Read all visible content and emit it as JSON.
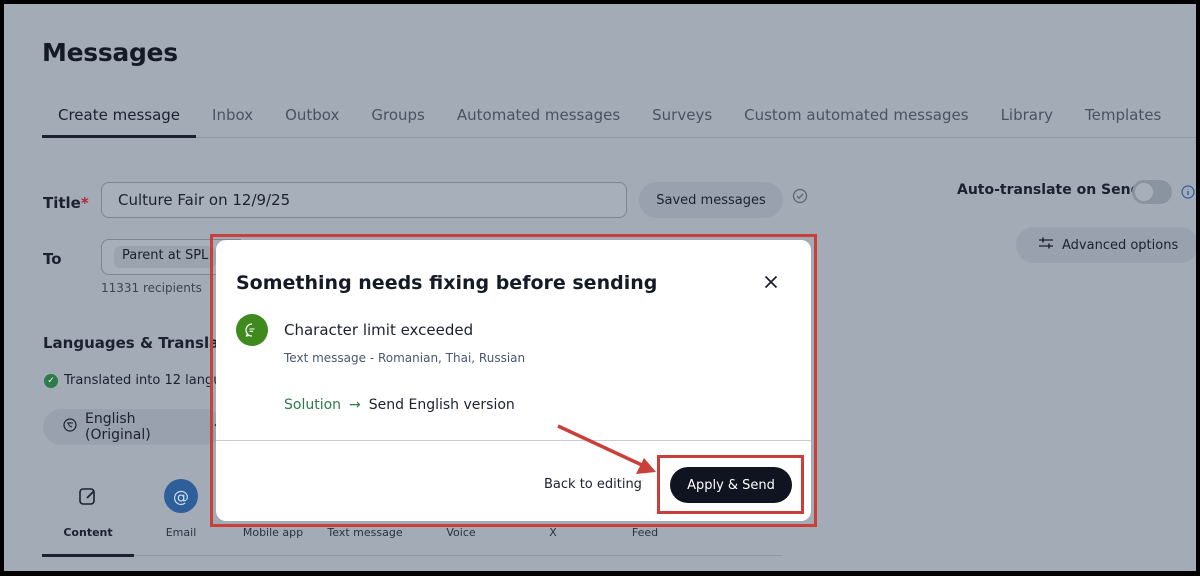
{
  "page": {
    "title": "Messages"
  },
  "tabs": [
    {
      "label": "Create message",
      "active": true
    },
    {
      "label": "Inbox"
    },
    {
      "label": "Outbox"
    },
    {
      "label": "Groups"
    },
    {
      "label": "Automated messages"
    },
    {
      "label": "Surveys"
    },
    {
      "label": "Custom automated messages"
    },
    {
      "label": "Library"
    },
    {
      "label": "Templates"
    }
  ],
  "form": {
    "title_label": "Title",
    "required_mark": "*",
    "title_value": "Culture Fair on 12/9/25",
    "saved_messages_label": "Saved messages",
    "to_label": "To",
    "to_chip": "Parent at SPL",
    "recipients": "11331 recipients",
    "languages_label": "Languages & Translation",
    "translated_note": "Translated into 12 langu",
    "language_pill": "English (Original)",
    "auto_translate_label": "Auto-translate on Send",
    "advanced_options_label": "Advanced options"
  },
  "channels": [
    {
      "label": "Content",
      "icon": "edit-icon",
      "active": true
    },
    {
      "label": "Email",
      "icon": "at-icon"
    },
    {
      "label": "Mobile app",
      "icon": ""
    },
    {
      "label": "Text message",
      "icon": ""
    },
    {
      "label": "Voice",
      "icon": ""
    },
    {
      "label": "X",
      "icon": ""
    },
    {
      "label": "Feed",
      "icon": ""
    }
  ],
  "modal": {
    "title": "Something needs fixing before sending",
    "issue_title": "Character limit exceeded",
    "issue_subtitle": "Text message - Romanian, Thai, Russian",
    "solution_label": "Solution",
    "solution_arrow": "→",
    "solution_text": "Send English version",
    "back_label": "Back to editing",
    "apply_label": "Apply & Send"
  },
  "colors": {
    "annotation": "#c9403a",
    "primary_button": "#0f1420",
    "success_green": "#2d7a4b",
    "issue_icon_green": "#3f8a1f"
  }
}
